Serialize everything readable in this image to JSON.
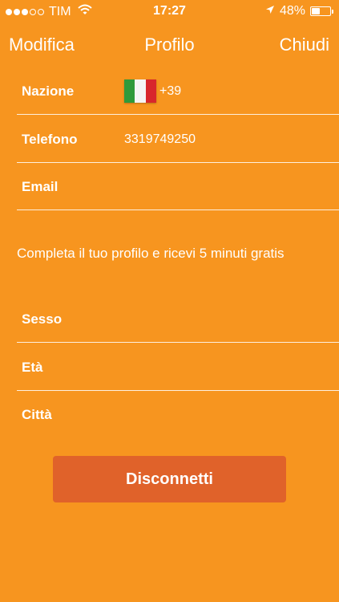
{
  "status_bar": {
    "carrier": "TIM",
    "time": "17:27",
    "battery_percent": "48%",
    "battery_level": 0.48
  },
  "nav": {
    "left_label": "Modifica",
    "title": "Profilo",
    "right_label": "Chiudi"
  },
  "fields": {
    "nazione": {
      "label": "Nazione",
      "flag_icon": "italy-flag-icon",
      "value": "+39"
    },
    "telefono": {
      "label": "Telefono",
      "value": "3319749250"
    },
    "email": {
      "label": "Email",
      "value": ""
    },
    "sesso": {
      "label": "Sesso",
      "value": ""
    },
    "eta": {
      "label": "Età",
      "value": ""
    },
    "citta": {
      "label": "Città",
      "value": ""
    }
  },
  "promo_text": "Completa il tuo profilo e ricevi 5 minuti gratis",
  "disconnect_button": "Disconnetti",
  "colors": {
    "background": "#F7951F",
    "button": "#E0622A"
  }
}
